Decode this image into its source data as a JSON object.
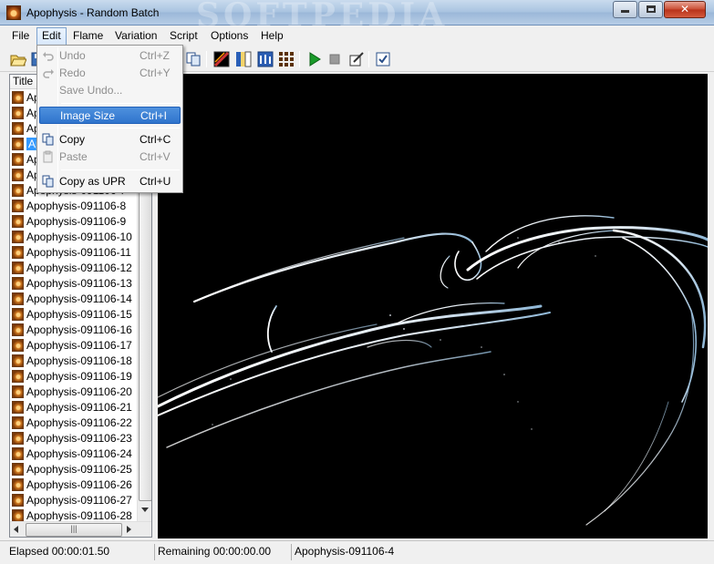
{
  "window": {
    "title": "Apophysis - Random Batch",
    "watermark": "SOFTPEDIA"
  },
  "menubar": {
    "items": [
      "File",
      "Edit",
      "Flame",
      "Variation",
      "Script",
      "Options",
      "Help"
    ]
  },
  "edit_menu": {
    "undo": {
      "label": "Undo",
      "shortcut": "Ctrl+Z"
    },
    "redo": {
      "label": "Redo",
      "shortcut": "Ctrl+Y"
    },
    "save_undo": {
      "label": "Save Undo..."
    },
    "image_size": {
      "label": "Image Size",
      "shortcut": "Ctrl+I"
    },
    "copy": {
      "label": "Copy",
      "shortcut": "Ctrl+C"
    },
    "paste": {
      "label": "Paste",
      "shortcut": "Ctrl+V"
    },
    "copy_upr": {
      "label": "Copy as UPR",
      "shortcut": "Ctrl+U"
    }
  },
  "toolbar": {
    "icons": [
      "open-folder-icon",
      "save-icon",
      "copy-icon",
      "gradient-icon",
      "color-icon",
      "adjust-icon",
      "mutate-icon",
      "render-start-icon",
      "render-stop-icon",
      "edit-icon",
      "options-icon"
    ]
  },
  "flame_list": {
    "header": "Title",
    "items": [
      "Apophysis-091106-1",
      "Apophysis-091106-2",
      "Apophysis-091106-3",
      "Apophysis-091106-4",
      "Apophysis-091106-5",
      "Apophysis-091106-6",
      "Apophysis-091106-7",
      "Apophysis-091106-8",
      "Apophysis-091106-9",
      "Apophysis-091106-10",
      "Apophysis-091106-11",
      "Apophysis-091106-12",
      "Apophysis-091106-13",
      "Apophysis-091106-14",
      "Apophysis-091106-15",
      "Apophysis-091106-16",
      "Apophysis-091106-17",
      "Apophysis-091106-18",
      "Apophysis-091106-19",
      "Apophysis-091106-20",
      "Apophysis-091106-21",
      "Apophysis-091106-22",
      "Apophysis-091106-23",
      "Apophysis-091106-24",
      "Apophysis-091106-25",
      "Apophysis-091106-26",
      "Apophysis-091106-27",
      "Apophysis-091106-28"
    ],
    "selected_index": 3
  },
  "status": {
    "elapsed": "Elapsed 00:00:01.50",
    "remaining": "Remaining 00:00:00.00",
    "current": "Apophysis-091106-4"
  }
}
